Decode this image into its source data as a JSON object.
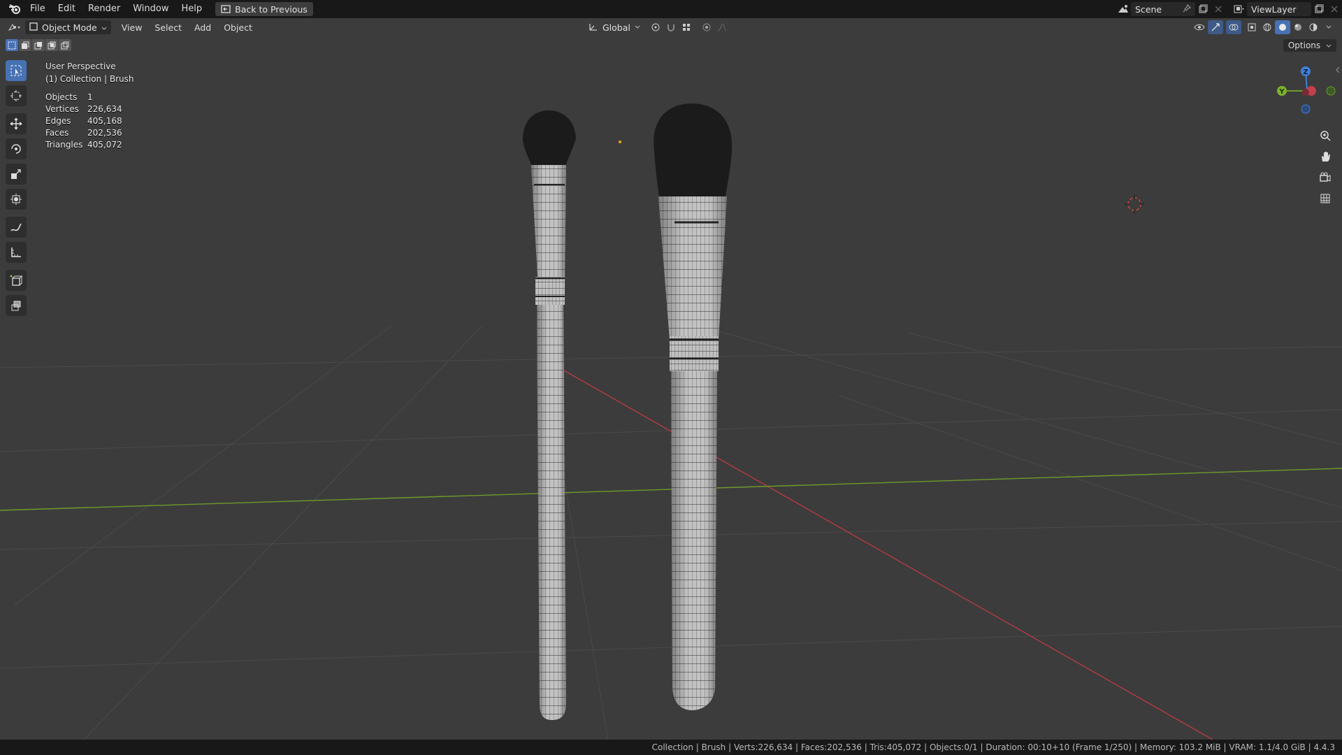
{
  "topbar": {
    "menus": [
      "File",
      "Edit",
      "Render",
      "Window",
      "Help"
    ],
    "back_button": "Back to Previous",
    "scene_label": "Scene",
    "viewlayer_label": "ViewLayer"
  },
  "viewport_header": {
    "mode": "Object Mode",
    "menus": [
      "View",
      "Select",
      "Add",
      "Object"
    ],
    "transform_orientation": "Global",
    "options_label": "Options"
  },
  "overlay": {
    "view_name": "User Perspective",
    "collection_info": "(1) Collection | Brush"
  },
  "stats": [
    {
      "label": "Objects",
      "value": "1"
    },
    {
      "label": "Vertices",
      "value": "226,634"
    },
    {
      "label": "Edges",
      "value": "405,168"
    },
    {
      "label": "Faces",
      "value": "202,536"
    },
    {
      "label": "Triangles",
      "value": "405,072"
    }
  ],
  "gizmo": {
    "z": "Z",
    "y": "Y"
  },
  "statusbar": {
    "text": "Collection | Brush | Verts:226,634 | Faces:202,536 | Tris:405,072 | Objects:0/1 | Duration: 00:10+10 (Frame 1/250) | Memory: 103.2 MiB | VRAM: 1.1/4.0 GiB | 4.4.3"
  },
  "colors": {
    "accent": "#4772b3",
    "x_axis": "#b53a44",
    "y_axis": "#6f9a2b",
    "z_axis": "#3f82d8",
    "viewport_bg": "#3c3c3c"
  }
}
